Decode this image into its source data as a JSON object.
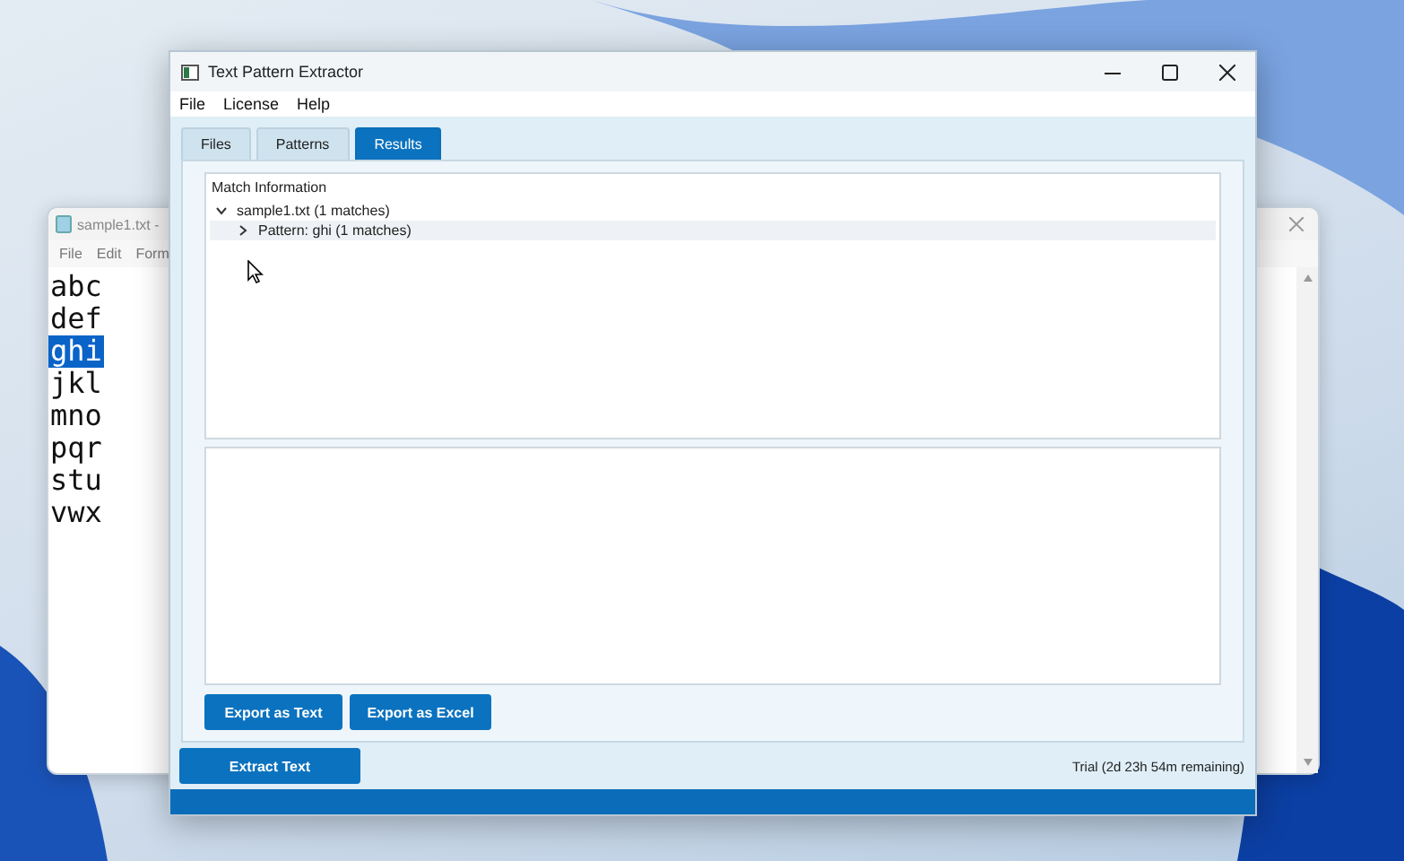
{
  "background_window": {
    "title": "sample1.txt -",
    "menu": [
      "File",
      "Edit",
      "Form"
    ],
    "lines": [
      {
        "text": "abc",
        "selected": false
      },
      {
        "text": "def",
        "selected": false
      },
      {
        "text": "ghi",
        "selected": true
      },
      {
        "text": "jkl",
        "selected": false
      },
      {
        "text": "mno",
        "selected": false
      },
      {
        "text": "pqr",
        "selected": false
      },
      {
        "text": "stu",
        "selected": false
      },
      {
        "text": "vwx",
        "selected": false
      }
    ]
  },
  "window": {
    "title": "Text Pattern Extractor"
  },
  "menu": [
    "File",
    "License",
    "Help"
  ],
  "tabs": [
    {
      "label": "Files",
      "selected": false
    },
    {
      "label": "Patterns",
      "selected": false
    },
    {
      "label": "Results",
      "selected": true
    }
  ],
  "tree": {
    "heading": "Match Information",
    "items": [
      {
        "label": "sample1.txt (1 matches)",
        "expanded": true,
        "selected": false,
        "children": [
          {
            "label": "Pattern: ghi (1 matches)",
            "expanded": false,
            "selected": true
          }
        ]
      }
    ]
  },
  "export_buttons": [
    "Export as Text",
    "Export as Excel"
  ],
  "extract_button": "Extract Text",
  "status": "Trial (2d 23h 54m remaining)"
}
